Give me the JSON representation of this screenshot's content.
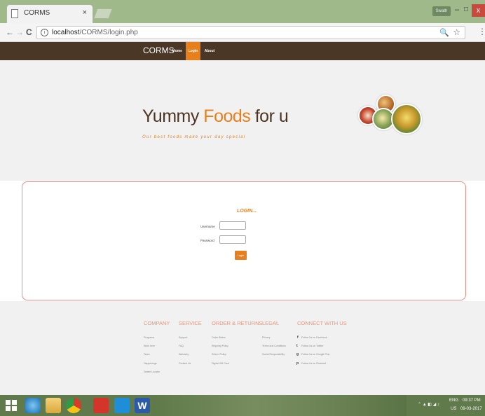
{
  "browser": {
    "tab_title": "CORMS",
    "tab_close": "×",
    "user_badge": "Swath",
    "url_host": "localhost",
    "url_path": "/CORMS/login.php",
    "back_glyph": "←",
    "forward_glyph": "→",
    "reload_glyph": "C",
    "zoom_glyph": "🔍",
    "star_glyph": "☆",
    "menu_glyph": "⋮",
    "min_glyph": "–",
    "max_glyph": "□",
    "close_glyph": "x"
  },
  "site": {
    "brand": "CORMS",
    "nav": [
      {
        "label": "Home"
      },
      {
        "label": "Login"
      },
      {
        "label": "About"
      }
    ],
    "hero": {
      "title_part1": "Yummy ",
      "title_accent": "Foods",
      "title_part2": " for u",
      "tagline": "Our best foods make your day special"
    },
    "login": {
      "heading": "LOGIN...",
      "username_label": "Username",
      "password_label": "Password",
      "username_value": "",
      "password_value": "",
      "button_label": "Login"
    },
    "footer": {
      "columns": [
        {
          "heading": "COMPANY",
          "links": [
            "Programs",
            "Work here",
            "Team",
            "Happenings",
            "Dealer Locator"
          ]
        },
        {
          "heading": "SERVICE",
          "links": [
            "Support",
            "FAQ",
            "Warranty",
            "Contact Us"
          ]
        },
        {
          "heading": "ORDER & RETURNS",
          "links": [
            "Order Status",
            "Shipping Policy",
            "Return Policy",
            "Digital Gift Card"
          ]
        },
        {
          "heading": "LEGAL",
          "links": [
            "Privacy",
            "Terms and Conditions",
            "Social Responsibility"
          ]
        },
        {
          "heading": "CONNECT WITH US",
          "links": [
            "Follow Us on Facebook",
            "Follow Us on Twitter",
            "Follow Us on Google Plus",
            "Follow Us on Pinterest"
          ]
        }
      ]
    }
  },
  "taskbar": {
    "language": "ENG",
    "region": "US",
    "time": "09:37 PM",
    "date": "09-03-2017"
  },
  "colors": {
    "accent": "#e7801c",
    "nav_bg": "#4a3726",
    "footer_heading": "#e8957a",
    "login_border": "#e58f86"
  }
}
